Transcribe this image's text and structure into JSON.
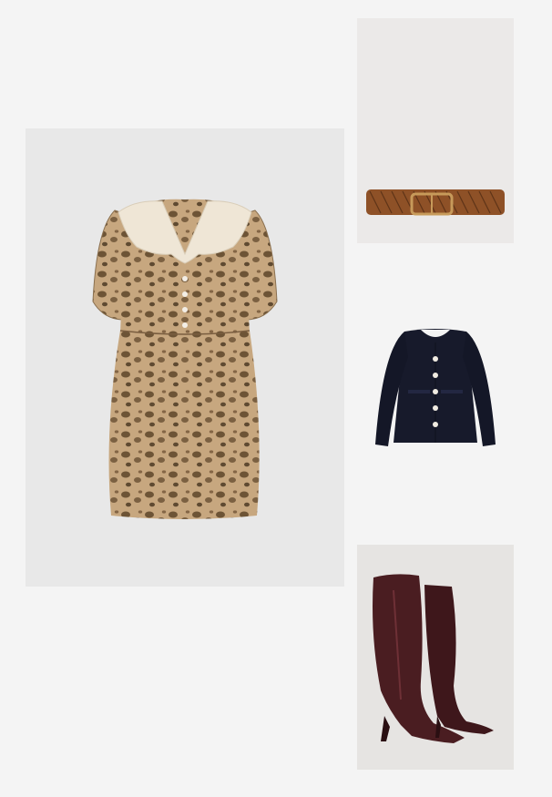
{
  "collage": {
    "background": "#f4f4f4",
    "items": [
      {
        "name": "leopard-print-dress",
        "colors": [
          "#c2a27a",
          "#6e5537",
          "#efe6d6"
        ]
      },
      {
        "name": "braided-leather-belt",
        "colors": [
          "#8e5127",
          "#c79a5a"
        ]
      },
      {
        "name": "navy-tweed-jacket",
        "colors": [
          "#171a2b",
          "#f1ece2"
        ]
      },
      {
        "name": "burgundy-knee-high-boots",
        "colors": [
          "#4a1d21",
          "#2a0f12"
        ]
      }
    ]
  }
}
